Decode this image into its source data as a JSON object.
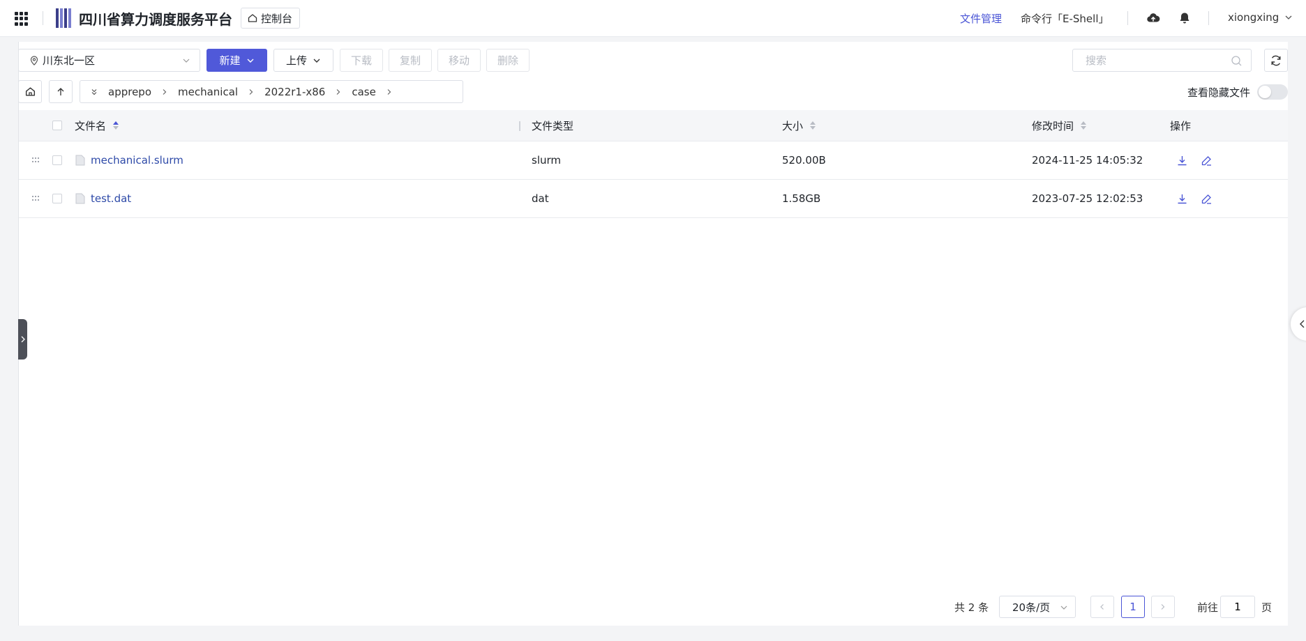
{
  "header": {
    "title": "四川省算力调度服务平台",
    "console_label": "控制台",
    "nav": {
      "file_manage": "文件管理",
      "shell": "命令行「E-Shell」"
    },
    "user": "xiongxing",
    "accent_color": "#4a55d6"
  },
  "toolbar": {
    "region": "川东北一区",
    "new_label": "新建",
    "upload_label": "上传",
    "download_label": "下载",
    "copy_label": "复制",
    "move_label": "移动",
    "delete_label": "删除",
    "search_placeholder": "搜索"
  },
  "path": {
    "segments": [
      "apprepo",
      "mechanical",
      "2022r1-x86",
      "case"
    ],
    "hidden_files_label": "查看隐藏文件"
  },
  "table": {
    "columns": {
      "name": "文件名",
      "type": "文件类型",
      "size": "大小",
      "mtime": "修改时间",
      "actions": "操作"
    },
    "rows": [
      {
        "name": "mechanical.slurm",
        "type": "slurm",
        "size": "520.00B",
        "mtime": "2024-11-25 14:05:32"
      },
      {
        "name": "test.dat",
        "type": "dat",
        "size": "1.58GB",
        "mtime": "2023-07-25 12:02:53"
      }
    ]
  },
  "pagination": {
    "total": "共 2 条",
    "page_size": "20条/页",
    "current_page": "1",
    "goto_label": "前往",
    "goto_value": "1",
    "page_suffix": "页"
  }
}
